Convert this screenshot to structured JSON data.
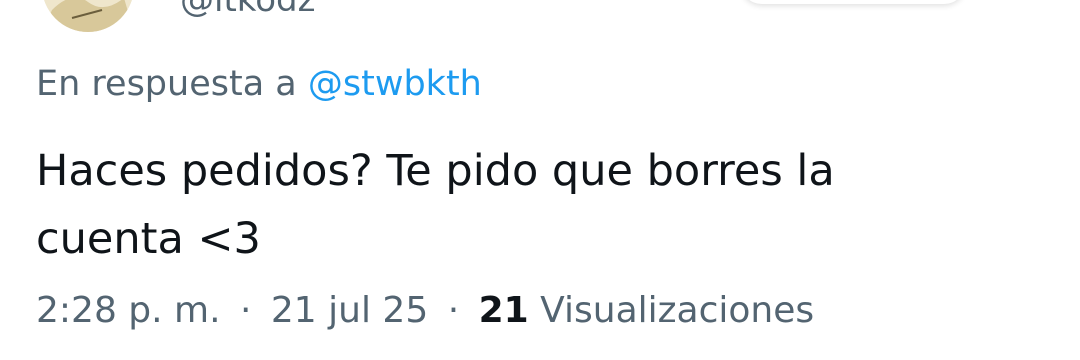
{
  "author": {
    "handle": "@itkodz"
  },
  "reply": {
    "prefix": "En respuesta a",
    "mention": "@stwbkth"
  },
  "tweet": {
    "line1": "Haces pedidos? Te pido que borres la",
    "line2": "cuenta <3"
  },
  "meta": {
    "time": "2:28 p. m.",
    "separator": "·",
    "date": "21 jul 25",
    "views_count": "21",
    "views_label": "Visualizaciones"
  },
  "colors": {
    "secondary_text": "#536471",
    "link": "#1d9bf0",
    "primary_text": "#0f1419"
  }
}
